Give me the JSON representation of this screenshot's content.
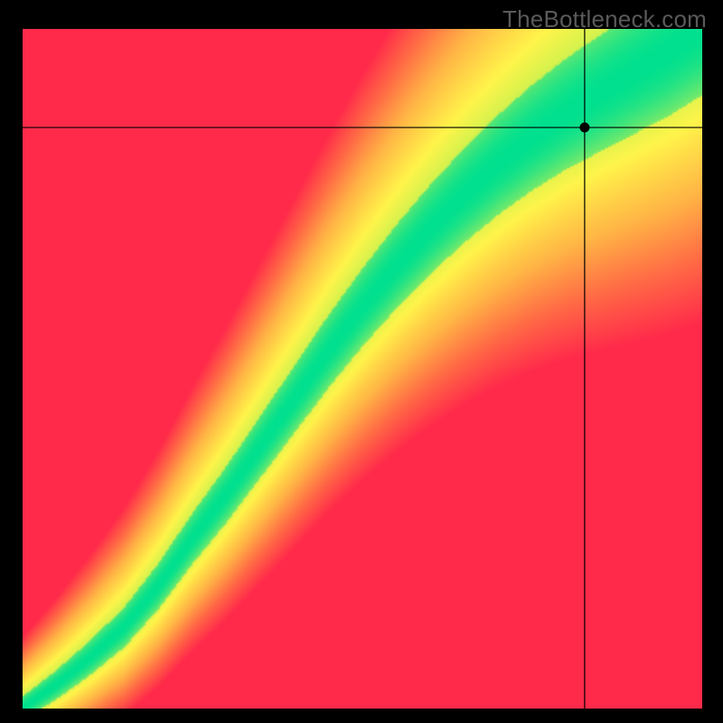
{
  "watermark": "TheBottleneck.com",
  "chart_data": {
    "type": "heatmap",
    "title": "",
    "xlabel": "",
    "ylabel": "",
    "xlim": [
      0,
      1
    ],
    "ylim": [
      0,
      1
    ],
    "crosshair": {
      "x": 0.827,
      "y": 0.855
    },
    "marker": {
      "x": 0.827,
      "y": 0.855
    },
    "ridge_curve": [
      {
        "x": 0.0,
        "y": 0.0
      },
      {
        "x": 0.05,
        "y": 0.035
      },
      {
        "x": 0.1,
        "y": 0.075
      },
      {
        "x": 0.15,
        "y": 0.12
      },
      {
        "x": 0.2,
        "y": 0.18
      },
      {
        "x": 0.25,
        "y": 0.25
      },
      {
        "x": 0.3,
        "y": 0.315
      },
      {
        "x": 0.35,
        "y": 0.385
      },
      {
        "x": 0.4,
        "y": 0.455
      },
      {
        "x": 0.45,
        "y": 0.525
      },
      {
        "x": 0.5,
        "y": 0.59
      },
      {
        "x": 0.55,
        "y": 0.65
      },
      {
        "x": 0.6,
        "y": 0.705
      },
      {
        "x": 0.65,
        "y": 0.755
      },
      {
        "x": 0.7,
        "y": 0.8
      },
      {
        "x": 0.75,
        "y": 0.84
      },
      {
        "x": 0.8,
        "y": 0.875
      },
      {
        "x": 0.85,
        "y": 0.905
      },
      {
        "x": 0.9,
        "y": 0.935
      },
      {
        "x": 0.95,
        "y": 0.965
      },
      {
        "x": 1.0,
        "y": 1.0
      }
    ],
    "band_half_width": 0.05,
    "color_scale": {
      "0.00": "#00e08f",
      "0.18": "#d8f24d",
      "0.30": "#fff44a",
      "0.55": "#ffb545",
      "0.78": "#ff6a45",
      "1.00": "#ff2a4a"
    },
    "grid": false,
    "legend": null
  }
}
